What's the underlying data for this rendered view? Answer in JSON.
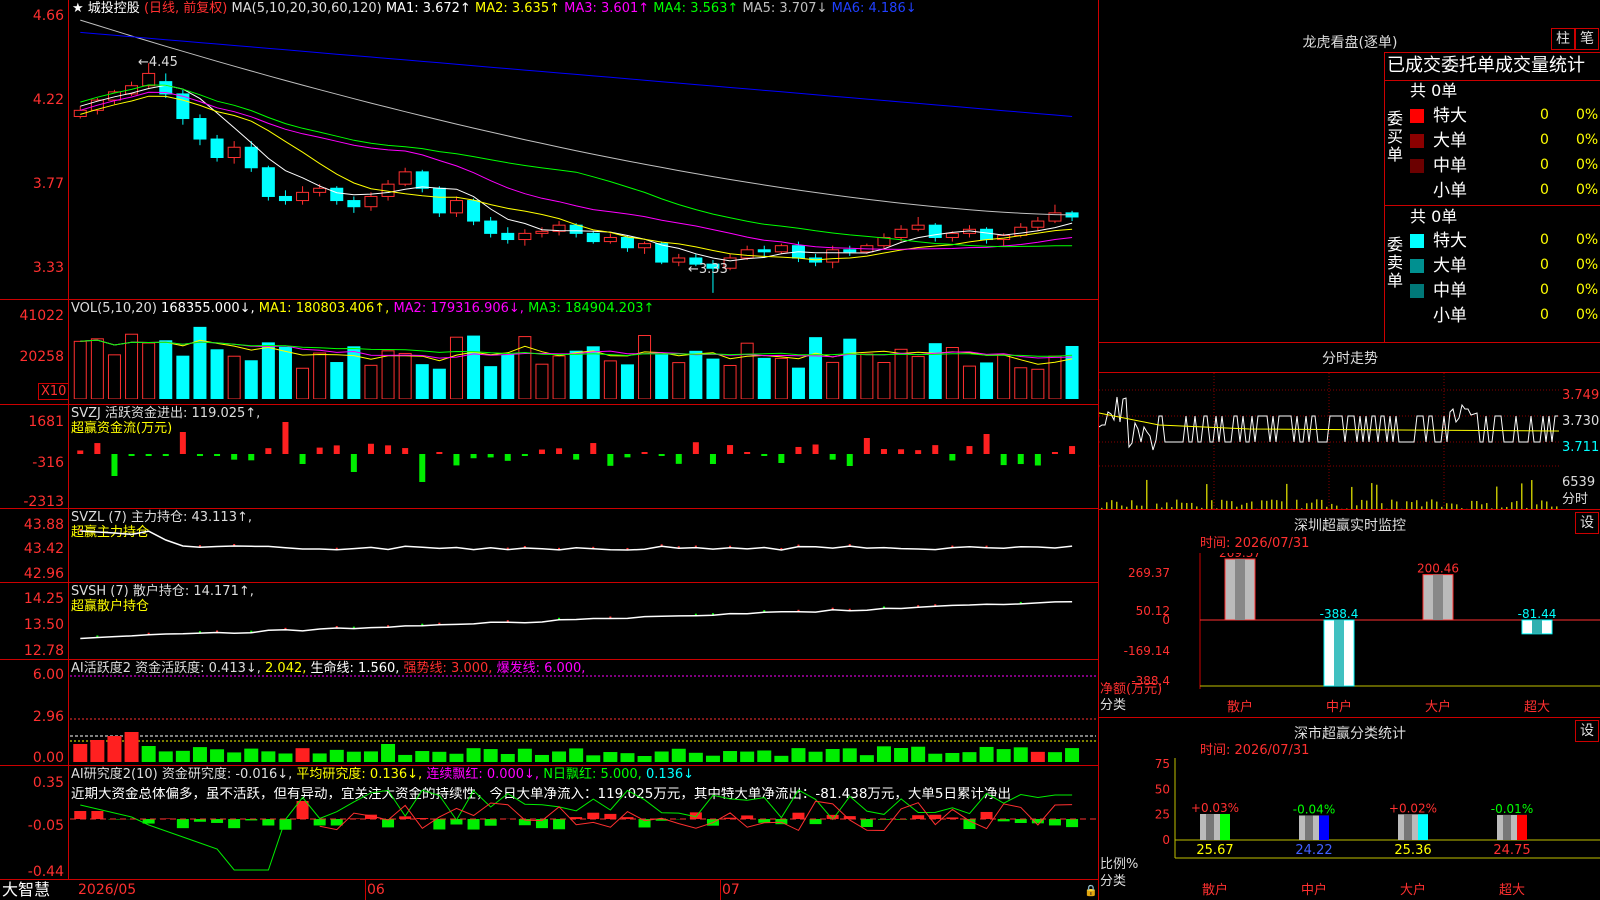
{
  "header": {
    "star": "★",
    "stock_name": "城投控股",
    "period": "(日线, 前复权)",
    "ma_params": "MA(5,10,20,30,60,120)",
    "ma1": "MA1: 3.672↑",
    "ma2": "MA2: 3.635↑",
    "ma3": "MA3: 3.601↑",
    "ma4": "MA4: 3.563↑",
    "ma5": "MA5: 3.707↓",
    "ma6": "MA6: 4.186↓"
  },
  "price_axis": [
    "4.66",
    "4.22",
    "3.77",
    "3.33"
  ],
  "price_annotations": {
    "high": "4.45",
    "low": "3.33"
  },
  "vol": {
    "title": "VOL(5,10,20)",
    "value": "168355.000↓,",
    "ma1": "MA1: 180803.406↑,",
    "ma2": "MA2: 179316.906↓,",
    "ma3": "MA3: 184904.203↑",
    "axis": [
      "41022",
      "20258"
    ],
    "unit": "X10"
  },
  "svzj": {
    "title": "SVZJ  活跃资金进出: 119.025↑,",
    "subtitle": "超赢资金流(万元)",
    "axis": [
      "1681",
      "-316",
      "-2313"
    ]
  },
  "svzl": {
    "title": "SVZL (7) 主力持仓: 43.113↑,",
    "subtitle": "超赢主力持仓",
    "axis": [
      "43.88",
      "43.42",
      "42.96"
    ]
  },
  "svsh": {
    "title": "SVSH (7) 散户持仓: 14.171↑,",
    "subtitle": "超赢散户持仓",
    "axis": [
      "14.25",
      "13.50",
      "12.78"
    ]
  },
  "ai_active": {
    "title": "AI活跃度2 资金活跃度: 0.413↓,",
    "v2": "2.042,",
    "v3": "生命线: 1.560,",
    "v4": "强势线: 3.000,",
    "v5": "爆发线: 6.000,",
    "axis": [
      "6.00",
      "2.96",
      "0.00"
    ]
  },
  "ai_research": {
    "title": "AI研究度2(10) 资金研究度: -0.016↓,",
    "v2": "平均研究度: 0.136↓,",
    "v3": "连续飘红: 0.000↓,",
    "v4": "N日飘红: 5.000,",
    "v5": "0.136↓",
    "comment": "近期大资金总体偏多，虽不活跃，但有异动，宜关注大资金的持续性，今日大单净流入：119.025万元，其中特大单净流出：-81.438万元，大单5日累计净出",
    "axis": [
      "0.35",
      "-0.05",
      "-0.44"
    ]
  },
  "footer": {
    "brand": "大智慧",
    "dates": [
      "2026/05",
      "06",
      "07"
    ]
  },
  "right": {
    "title": "龙虎看盘(逐单)",
    "btn1": "柱",
    "btn2": "笔",
    "stat_title": "已成交委托单成交量统计",
    "buy_label": "委买单",
    "sell_label": "委卖单",
    "buy_total": "共 0单",
    "sell_total": "共 0单",
    "buy_rows": [
      {
        "name": "特大",
        "vol": "0",
        "pct": "0%",
        "color": "#ff0000"
      },
      {
        "name": "大单",
        "vol": "0",
        "pct": "0%",
        "color": "#8b0000"
      },
      {
        "name": "中单",
        "vol": "0",
        "pct": "0%",
        "color": "#6b0000"
      },
      {
        "name": "小单",
        "vol": "0",
        "pct": "0%",
        "color": "#000000"
      }
    ],
    "sell_rows": [
      {
        "name": "特大",
        "vol": "0",
        "pct": "0%",
        "color": "#00ffff"
      },
      {
        "name": "大单",
        "vol": "0",
        "pct": "0%",
        "color": "#009090"
      },
      {
        "name": "中单",
        "vol": "0",
        "pct": "0%",
        "color": "#007878"
      },
      {
        "name": "小单",
        "vol": "0",
        "pct": "0%",
        "color": "#000000"
      }
    ],
    "intraday_title": "分时走势",
    "intraday_axis": [
      "3.749",
      "3.730",
      "3.711"
    ],
    "intraday_vol_label": "6539",
    "intraday_vol_unit": "分时",
    "monitor_title": "深圳超赢实时监控",
    "monitor_btn": "设",
    "monitor_time": "时间: 2026/07/31",
    "monitor_axis": [
      "269.37",
      "50.12",
      "0",
      "-169.14",
      "-388.4"
    ],
    "monitor_unit": "净额(万元)",
    "monitor_cat_label": "分类",
    "monitor_values": [
      {
        "cat": "散户",
        "label": "269.37",
        "value": 269.37
      },
      {
        "cat": "中户",
        "label": "-388.4",
        "value": -388.4
      },
      {
        "cat": "大户",
        "label": "200.46",
        "value": 200.46
      },
      {
        "cat": "超大",
        "label": "-81.44",
        "value": -81.44
      }
    ],
    "class_title": "深市超赢分类统计",
    "class_btn": "设",
    "class_time": "时间: 2026/07/31",
    "class_axis": [
      "75",
      "50",
      "25",
      "0"
    ],
    "class_unit": "比例%",
    "class_cat_label": "分类",
    "class_values": [
      {
        "cat": "散户",
        "change": "+0.03%",
        "value": "25.67",
        "color": "#00ff00"
      },
      {
        "cat": "中户",
        "change": "-0.04%",
        "value": "24.22",
        "color": "#0000ff"
      },
      {
        "cat": "大户",
        "change": "+0.02%",
        "value": "25.36",
        "color": "#00ffff"
      },
      {
        "cat": "超大",
        "change": "-0.01%",
        "value": "24.75",
        "color": "#ff0000"
      }
    ]
  },
  "chart_data": {
    "type": "candlestick",
    "ylim": [
      3.3,
      4.68
    ],
    "candles": [
      [
        4.19,
        4.24,
        4.18,
        4.22
      ],
      [
        4.22,
        4.28,
        4.2,
        4.27
      ],
      [
        4.27,
        4.32,
        4.25,
        4.31
      ],
      [
        4.3,
        4.36,
        4.29,
        4.34
      ],
      [
        4.34,
        4.45,
        4.33,
        4.4
      ],
      [
        4.36,
        4.4,
        4.28,
        4.3
      ],
      [
        4.3,
        4.32,
        4.15,
        4.18
      ],
      [
        4.18,
        4.2,
        4.05,
        4.08
      ],
      [
        4.08,
        4.1,
        3.97,
        3.99
      ],
      [
        3.99,
        4.07,
        3.96,
        4.04
      ],
      [
        4.04,
        4.07,
        3.92,
        3.94
      ],
      [
        3.94,
        3.95,
        3.78,
        3.8
      ],
      [
        3.8,
        3.83,
        3.76,
        3.78
      ],
      [
        3.78,
        3.85,
        3.76,
        3.82
      ],
      [
        3.82,
        3.86,
        3.8,
        3.84
      ],
      [
        3.84,
        3.85,
        3.76,
        3.78
      ],
      [
        3.78,
        3.8,
        3.72,
        3.75
      ],
      [
        3.75,
        3.82,
        3.73,
        3.8
      ],
      [
        3.8,
        3.88,
        3.78,
        3.86
      ],
      [
        3.86,
        3.94,
        3.85,
        3.92
      ],
      [
        3.92,
        3.93,
        3.82,
        3.84
      ],
      [
        3.84,
        3.85,
        3.7,
        3.72
      ],
      [
        3.72,
        3.8,
        3.7,
        3.78
      ],
      [
        3.78,
        3.79,
        3.66,
        3.68
      ],
      [
        3.68,
        3.7,
        3.6,
        3.62
      ],
      [
        3.62,
        3.65,
        3.57,
        3.59
      ],
      [
        3.59,
        3.64,
        3.56,
        3.62
      ],
      [
        3.62,
        3.65,
        3.6,
        3.63
      ],
      [
        3.63,
        3.68,
        3.61,
        3.66
      ],
      [
        3.66,
        3.67,
        3.6,
        3.62
      ],
      [
        3.62,
        3.63,
        3.57,
        3.58
      ],
      [
        3.58,
        3.62,
        3.57,
        3.6
      ],
      [
        3.6,
        3.61,
        3.53,
        3.55
      ],
      [
        3.55,
        3.58,
        3.52,
        3.57
      ],
      [
        3.57,
        3.58,
        3.47,
        3.48
      ],
      [
        3.48,
        3.52,
        3.46,
        3.5
      ],
      [
        3.5,
        3.52,
        3.46,
        3.47
      ],
      [
        3.47,
        3.49,
        3.33,
        3.45
      ],
      [
        3.45,
        3.52,
        3.44,
        3.5
      ],
      [
        3.5,
        3.56,
        3.49,
        3.54
      ],
      [
        3.54,
        3.56,
        3.5,
        3.53
      ],
      [
        3.53,
        3.57,
        3.52,
        3.56
      ],
      [
        3.56,
        3.58,
        3.48,
        3.5
      ],
      [
        3.5,
        3.52,
        3.46,
        3.48
      ],
      [
        3.48,
        3.56,
        3.45,
        3.54
      ],
      [
        3.54,
        3.56,
        3.51,
        3.53
      ],
      [
        3.53,
        3.57,
        3.52,
        3.56
      ],
      [
        3.56,
        3.62,
        3.54,
        3.6
      ],
      [
        3.6,
        3.66,
        3.58,
        3.64
      ],
      [
        3.64,
        3.7,
        3.63,
        3.66
      ],
      [
        3.66,
        3.67,
        3.58,
        3.6
      ],
      [
        3.6,
        3.63,
        3.58,
        3.62
      ],
      [
        3.62,
        3.66,
        3.6,
        3.64
      ],
      [
        3.64,
        3.65,
        3.57,
        3.59
      ],
      [
        3.59,
        3.62,
        3.56,
        3.61
      ],
      [
        3.61,
        3.67,
        3.6,
        3.65
      ],
      [
        3.65,
        3.7,
        3.63,
        3.68
      ],
      [
        3.68,
        3.76,
        3.67,
        3.72
      ],
      [
        3.72,
        3.73,
        3.68,
        3.7
      ]
    ],
    "ma_series": [
      {
        "name": "MA1",
        "color": "#ffffff",
        "values_start": 4.24,
        "values_end": 3.67
      },
      {
        "name": "MA2",
        "color": "#ffff00",
        "values_start": 4.2,
        "values_end": 3.64
      },
      {
        "name": "MA3",
        "color": "#ff00ff",
        "values_start": 4.22,
        "values_end": 3.6
      },
      {
        "name": "MA4",
        "color": "#00ff00",
        "values_start": 4.26,
        "values_end": 3.56
      },
      {
        "name": "MA5",
        "color": "#c0c0c0",
        "values_start": 4.66,
        "values_end": 3.71
      },
      {
        "name": "MA6",
        "color": "#0000ff",
        "values_start": 4.6,
        "values_end": 4.19
      }
    ]
  }
}
